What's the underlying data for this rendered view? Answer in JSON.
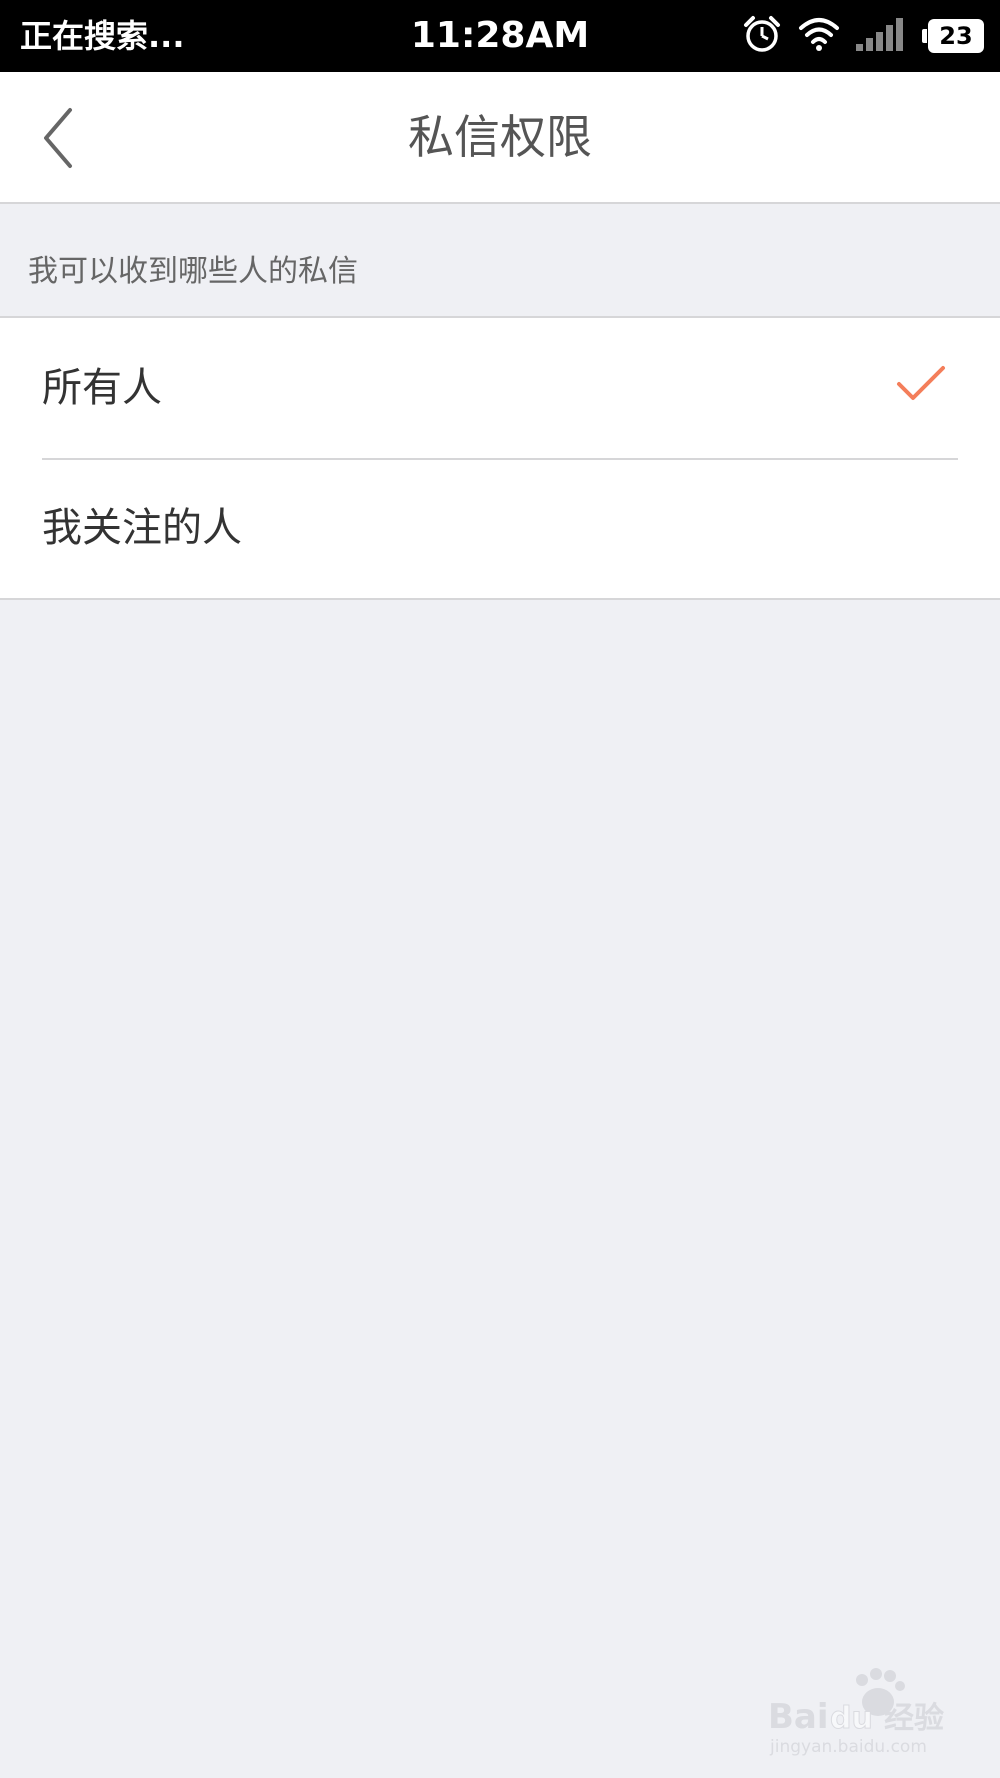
{
  "status_bar": {
    "left_text": "正在搜索...",
    "time": "11:28AM",
    "battery_level": "23",
    "icons": [
      "alarm-icon",
      "wifi-icon",
      "signal-icon",
      "battery-icon"
    ]
  },
  "nav": {
    "title": "私信权限",
    "back_icon": "chevron-left-icon"
  },
  "section": {
    "header": "我可以收到哪些人的私信"
  },
  "options": [
    {
      "label": "所有人",
      "selected": true
    },
    {
      "label": "我关注的人",
      "selected": false
    }
  ],
  "colors": {
    "accent": "#f47e5a",
    "background": "#eff0f4",
    "divider": "#d6d6d8"
  },
  "watermark": {
    "brand": "Bai du 经验",
    "url": "jingyan.baidu.com"
  }
}
